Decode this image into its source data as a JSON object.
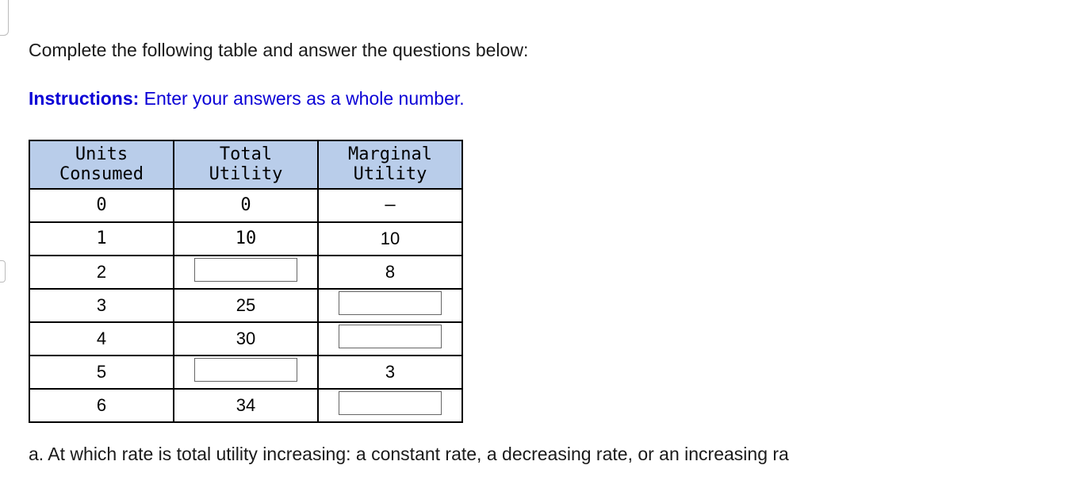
{
  "prompt": "Complete the following table and answer the questions below:",
  "instructions": {
    "label": "Instructions:",
    "text": " Enter your answers as a whole number."
  },
  "table": {
    "headers": {
      "units_line1": "Units",
      "units_line2": "Consumed",
      "total_line1": "Total",
      "total_line2": "Utility",
      "marginal_line1": "Marginal",
      "marginal_line2": "Utility"
    },
    "rows": [
      {
        "units": "0",
        "total": "0",
        "marginal": "–",
        "total_input": false,
        "marginal_input": false
      },
      {
        "units": "1",
        "total": "10",
        "marginal": "10",
        "total_input": false,
        "marginal_input": false
      },
      {
        "units": "2",
        "total": "",
        "marginal": "8",
        "total_input": true,
        "marginal_input": false
      },
      {
        "units": "3",
        "total": "25",
        "marginal": "",
        "total_input": false,
        "marginal_input": true
      },
      {
        "units": "4",
        "total": "30",
        "marginal": "",
        "total_input": false,
        "marginal_input": true
      },
      {
        "units": "5",
        "total": "",
        "marginal": "3",
        "total_input": true,
        "marginal_input": false
      },
      {
        "units": "6",
        "total": "34",
        "marginal": "",
        "total_input": false,
        "marginal_input": true
      }
    ]
  },
  "question_a": "a. At which rate is total utility increasing: a constant rate, a decreasing rate, or an increasing ra"
}
